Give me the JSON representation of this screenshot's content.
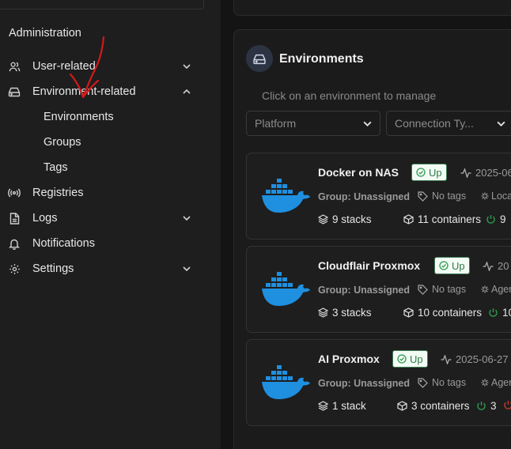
{
  "sidebar": {
    "section_title": "Administration",
    "items": [
      {
        "label": "User-related",
        "icon": "users-icon",
        "chevron": "down"
      },
      {
        "label": "Environment-related",
        "icon": "drive-icon",
        "chevron": "up"
      },
      {
        "label": "Registries",
        "icon": "radio-icon"
      },
      {
        "label": "Logs",
        "icon": "file-icon",
        "chevron": "down"
      },
      {
        "label": "Notifications",
        "icon": "bell-icon"
      },
      {
        "label": "Settings",
        "icon": "gear-icon",
        "chevron": "down"
      }
    ],
    "sub_items": [
      "Environments",
      "Groups",
      "Tags"
    ]
  },
  "panel": {
    "title": "Environments",
    "hint": "Click on an environment to manage",
    "filters": {
      "platform": "Platform",
      "connection": "Connection Ty..."
    }
  },
  "environments": [
    {
      "name": "Docker on NAS",
      "status": "Up",
      "timestamp": "2025-06",
      "group": "Group: Unassigned",
      "tags": "No tags",
      "agent": "Loca",
      "stacks": "9 stacks",
      "containers": "11 containers",
      "running": "9"
    },
    {
      "name": "Cloudflair Proxmox",
      "status": "Up",
      "timestamp": "20",
      "group": "Group: Unassigned",
      "tags": "No tags",
      "agent": "Ager",
      "stacks": "3 stacks",
      "containers": "10 containers",
      "running": "10"
    },
    {
      "name": "AI Proxmox",
      "status": "Up",
      "timestamp": "2025-06-27",
      "group": "Group: Unassigned",
      "tags": "No tags",
      "agent": "Ager",
      "stacks": "1 stack",
      "containers": "3 containers",
      "running": "3"
    }
  ],
  "colors": {
    "accent_blue": "#1f8fe0",
    "status_green": "#2e9a4e",
    "status_red": "#c0392b",
    "annotation_red": "#d11a1a"
  }
}
